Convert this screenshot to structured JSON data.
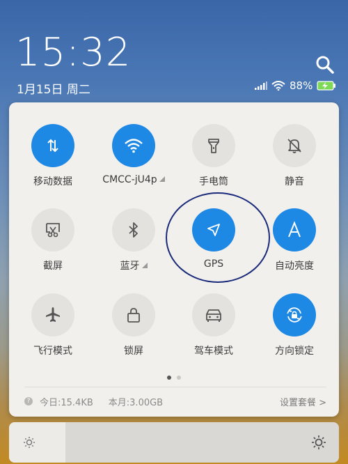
{
  "status": {
    "time": "15:32",
    "date": "1月15日 周二",
    "battery_percent": "88%"
  },
  "tiles": [
    {
      "label": "移动数据",
      "icon": "data-arrows-icon",
      "state": "on"
    },
    {
      "label": "CMCC-jU4p",
      "icon": "wifi-icon",
      "state": "on"
    },
    {
      "label": "手电筒",
      "icon": "flashlight-icon",
      "state": "off"
    },
    {
      "label": "静音",
      "icon": "bell-mute-icon",
      "state": "off"
    },
    {
      "label": "截屏",
      "icon": "screenshot-icon",
      "state": "off"
    },
    {
      "label": "蓝牙",
      "icon": "bluetooth-icon",
      "state": "off"
    },
    {
      "label": "GPS",
      "icon": "navigation-arrow-icon",
      "state": "on"
    },
    {
      "label": "自动亮度",
      "icon": "auto-brightness-icon",
      "state": "on"
    },
    {
      "label": "飞行模式",
      "icon": "airplane-icon",
      "state": "off"
    },
    {
      "label": "锁屏",
      "icon": "lock-icon",
      "state": "off"
    },
    {
      "label": "驾车模式",
      "icon": "car-icon",
      "state": "off"
    },
    {
      "label": "方向锁定",
      "icon": "rotation-lock-icon",
      "state": "on"
    }
  ],
  "footer": {
    "today": "今日:15.4KB",
    "month": "本月:3.00GB",
    "settings": "设置套餐 >"
  },
  "brightness_level": 0.17,
  "colors": {
    "accent": "#1e88e5",
    "annotation": "#1a2a7a"
  }
}
